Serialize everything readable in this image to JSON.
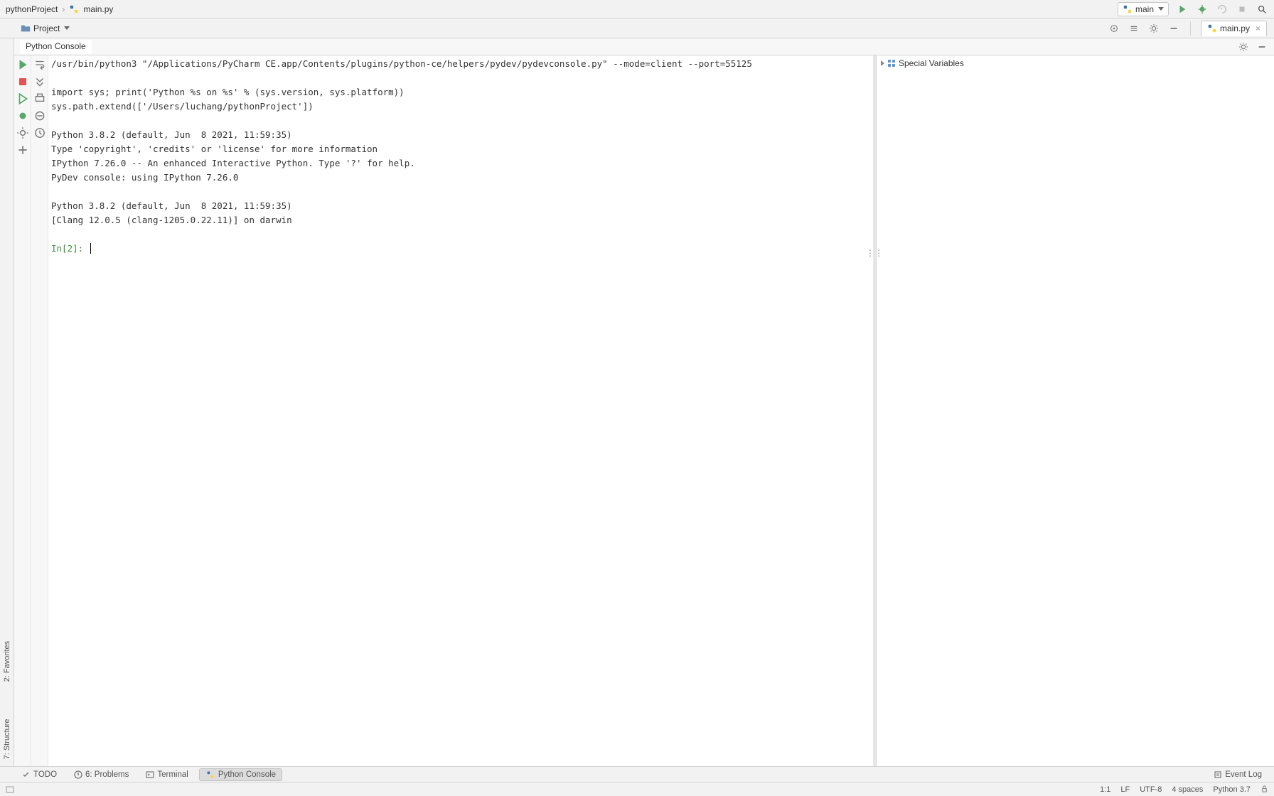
{
  "breadcrumb": {
    "project": "pythonProject",
    "file": "main.py"
  },
  "run_config": {
    "label": "main"
  },
  "project_tool": {
    "label": "Project"
  },
  "editor_tab": {
    "label": "main.py"
  },
  "console": {
    "title": "Python Console",
    "line_interpreter": "/usr/bin/python3 \"/Applications/PyCharm CE.app/Contents/plugins/python-ce/helpers/pydev/pydevconsole.py\" --mode=client --port=55125",
    "line_import": "import sys; print('Python %s on %s' % (sys.version, sys.platform))",
    "line_syspath": "sys.path.extend(['/Users/luchang/pythonProject'])",
    "line_pyver1": "Python 3.8.2 (default, Jun  8 2021, 11:59:35)",
    "line_typeinfo": "Type 'copyright', 'credits' or 'license' for more information",
    "line_ipython": "IPython 7.26.0 -- An enhanced Interactive Python. Type '?' for help.",
    "line_pydev": "PyDev console: using IPython 7.26.0",
    "line_pyver2": "Python 3.8.2 (default, Jun  8 2021, 11:59:35)",
    "line_clang": "[Clang 12.0.5 (clang-1205.0.22.11)] on darwin",
    "prompt": "In[2]: "
  },
  "variables": {
    "special_label": "Special Variables"
  },
  "left_sidebar": {
    "structure": "7: Structure",
    "favorites": "2: Favorites"
  },
  "bottom_tabs": {
    "todo": "TODO",
    "problems": "6: Problems",
    "terminal": "Terminal",
    "python_console": "Python Console",
    "event_log": "Event Log"
  },
  "status": {
    "position": "1:1",
    "line_ending": "LF",
    "encoding": "UTF-8",
    "indent": "4 spaces",
    "interpreter": "Python 3.7"
  }
}
